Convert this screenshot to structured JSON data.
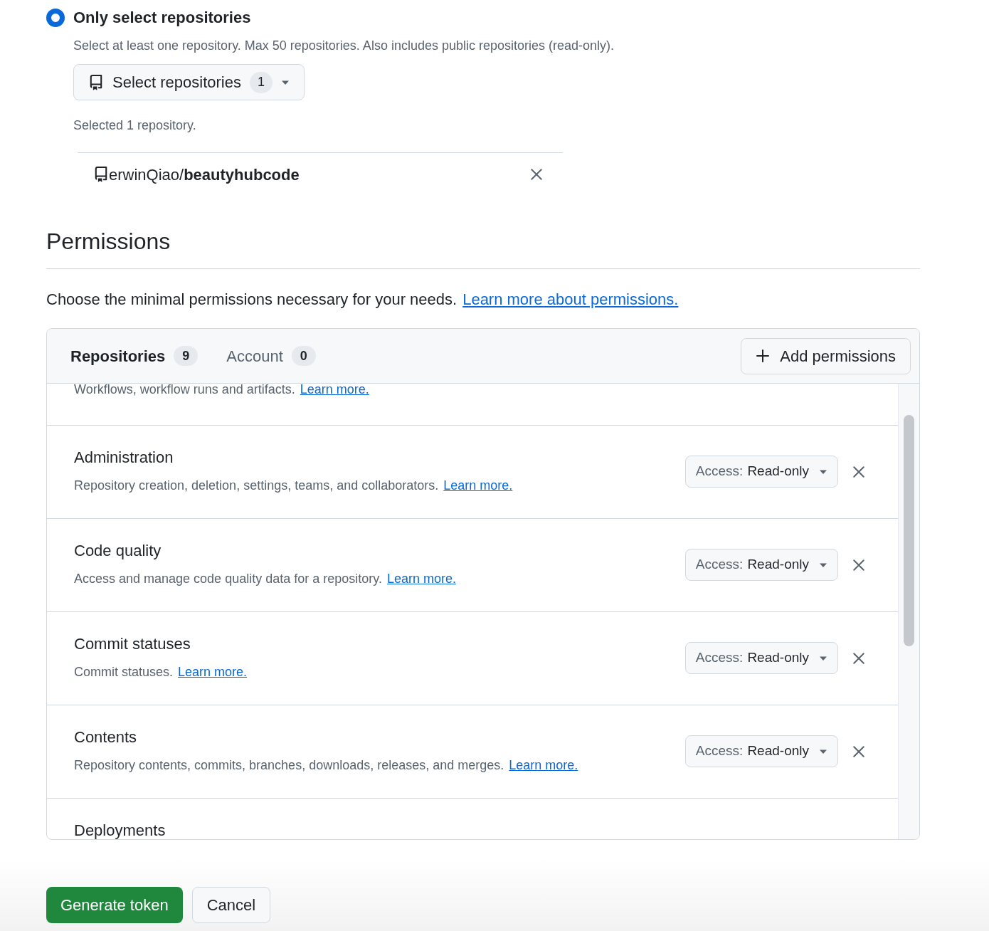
{
  "repository_access": {
    "option": {
      "label": "Only select repositories",
      "selected": true,
      "description": "Select at least one repository. Max 50 repositories. Also includes public repositories (read-only)."
    },
    "select_button": {
      "label": "Select repositories",
      "count": "1"
    },
    "selected_summary": "Selected 1 repository.",
    "selected_repos": [
      {
        "owner": "erwinQiao/",
        "name": "beautyhubcode"
      }
    ]
  },
  "permissions": {
    "title": "Permissions",
    "intro": "Choose the minimal permissions necessary for your needs.",
    "intro_link": "Learn more about permissions.",
    "tabs": [
      {
        "label": "Repositories",
        "count": "9",
        "selected": true
      },
      {
        "label": "Account",
        "count": "0",
        "selected": false
      }
    ],
    "add_button": "Add permissions",
    "rows": [
      {
        "description": "Workflows, workflow runs and artifacts.",
        "link": "Learn more."
      },
      {
        "title": "Administration",
        "description": "Repository creation, deletion, settings, teams, and collaborators.",
        "link": "Learn more.",
        "access_label": "Access:",
        "access_value": "Read-only"
      },
      {
        "title": "Code quality",
        "description": "Access and manage code quality data for a repository.",
        "link": "Learn more.",
        "access_label": "Access:",
        "access_value": "Read-only"
      },
      {
        "title": "Commit statuses",
        "description": "Commit statuses.",
        "link": "Learn more.",
        "access_label": "Access:",
        "access_value": "Read-only"
      },
      {
        "title": "Contents",
        "description": "Repository contents, commits, branches, downloads, releases, and merges.",
        "link": "Learn more.",
        "access_label": "Access:",
        "access_value": "Read-only"
      },
      {
        "title": "Deployments"
      }
    ]
  },
  "actions": {
    "primary": "Generate token",
    "secondary": "Cancel"
  }
}
